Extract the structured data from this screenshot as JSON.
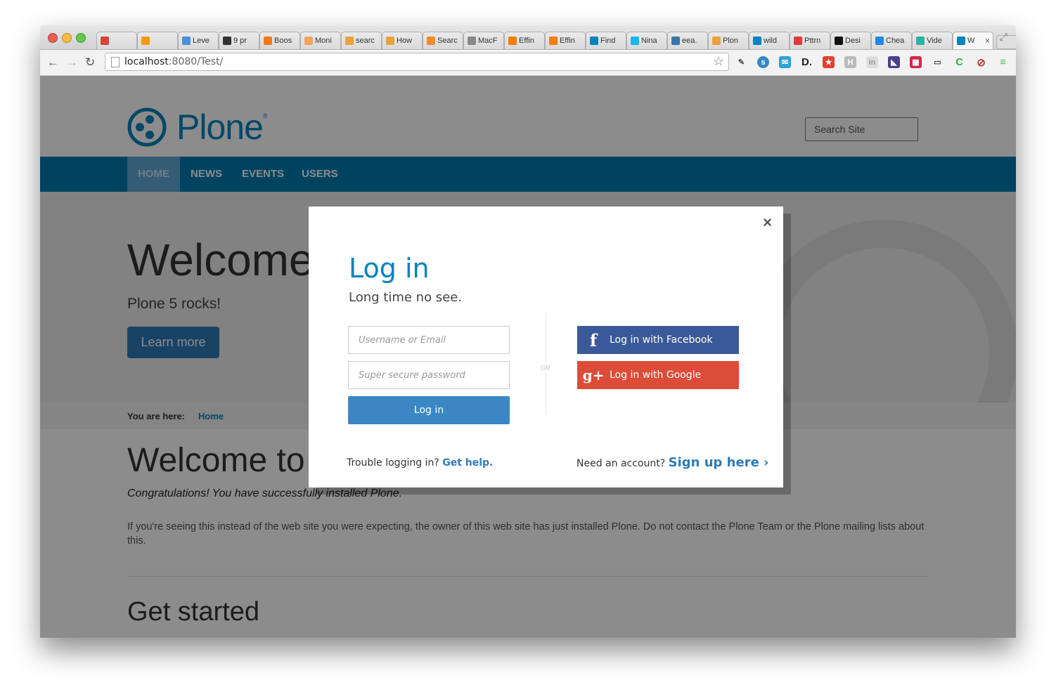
{
  "browser": {
    "tabs": [
      {
        "label": "",
        "color": "#d44638"
      },
      {
        "label": "",
        "color": "#f39c12"
      },
      {
        "label": "Leve",
        "color": "#4a90d9"
      },
      {
        "label": "9 pr",
        "color": "#333333"
      },
      {
        "label": "Boos",
        "color": "#f07a1a"
      },
      {
        "label": "Moni",
        "color": "#f4a261"
      },
      {
        "label": "searc",
        "color": "#e9a23b"
      },
      {
        "label": "How",
        "color": "#e9a23b"
      },
      {
        "label": "Searc",
        "color": "#f08c2a"
      },
      {
        "label": "MacF",
        "color": "#888888"
      },
      {
        "label": "Effin",
        "color": "#f57d00"
      },
      {
        "label": "Effin",
        "color": "#f57d00"
      },
      {
        "label": "Find",
        "color": "#0083be"
      },
      {
        "label": "Nina",
        "color": "#1ab7ea"
      },
      {
        "label": "eea.",
        "color": "#3776ab"
      },
      {
        "label": "Plon",
        "color": "#e9a23b"
      },
      {
        "label": "wild",
        "color": "#0083be"
      },
      {
        "label": "Pttrn",
        "color": "#e03a3a"
      },
      {
        "label": "Desi",
        "color": "#111111"
      },
      {
        "label": "Chea",
        "color": "#1e88e5"
      },
      {
        "label": "Vide",
        "color": "#26b5a4"
      },
      {
        "label": "W",
        "color": "#0083be",
        "active": true
      }
    ],
    "url_host": "localhost",
    "url_rest": ":8080/Test/"
  },
  "site": {
    "logo_text": "Plone",
    "logo_reg": "®",
    "search_placeholder": "Search Site",
    "nav": [
      "HOME",
      "NEWS",
      "EVENTS",
      "USERS"
    ],
    "hero_title": "Welcome",
    "hero_sub": "Plone 5 rocks!",
    "learn_more": "Learn more",
    "breadcrumb_label": "You are here:",
    "breadcrumb_home": "Home",
    "content_title": "Welcome to",
    "congrats": "Congratulations! You have successfully installed Plone.",
    "para": "If you're seeing this instead of the web site you were expecting, the owner of this web site has just installed Plone. Do not contact the Plone Team or the Plone mailing lists about this.",
    "get_started": "Get started"
  },
  "modal": {
    "close": "×",
    "title": "Log in",
    "subtitle": "Long time no see.",
    "username_placeholder": "Username or Email",
    "password_placeholder": "Super secure password",
    "login_button": "Log in",
    "or_label": "OR",
    "facebook_button": "Log in with Facebook",
    "google_button": "Log in with Google",
    "trouble_text": "Trouble logging in?",
    "get_help": "Get help.",
    "need_account": "Need an account?",
    "sign_up": "Sign up here ›"
  }
}
